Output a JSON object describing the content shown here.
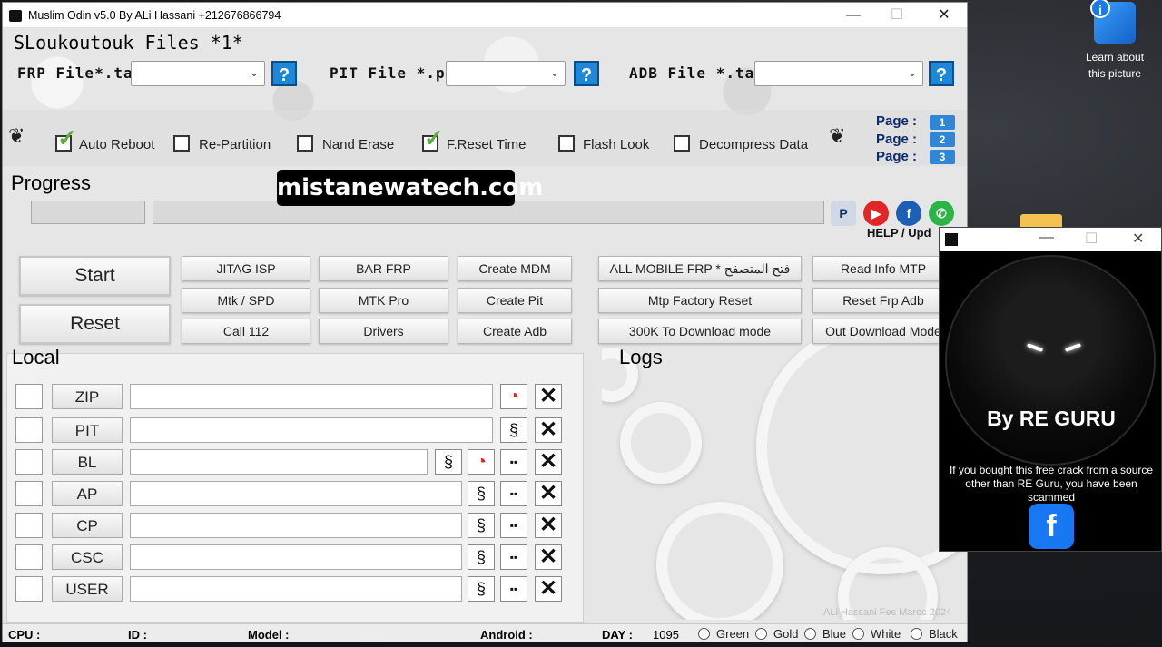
{
  "desktop": {
    "icon_label": "Learn about this picture"
  },
  "window": {
    "title": "Muslim Odin v5.0 By ALi Hassani +212676866794",
    "minimize": "—",
    "maximize": "☐",
    "close": "✕"
  },
  "header": {
    "files_label": "SLoukoutouk Files *1*",
    "frp_label": "FRP File*.tar",
    "pit_label": "PIT File *.pit",
    "adb_label": "ADB File *.tar",
    "help_glyph": "?"
  },
  "options": {
    "items": [
      {
        "label": "Auto Reboot",
        "checked": true
      },
      {
        "label": "Re-Partition",
        "checked": false
      },
      {
        "label": "Nand Erase",
        "checked": false
      },
      {
        "label": "F.Reset Time",
        "checked": true
      },
      {
        "label": "Flash Look",
        "checked": false
      },
      {
        "label": "Decompress Data",
        "checked": false
      }
    ],
    "pages": [
      {
        "label": "Page :",
        "num": "1"
      },
      {
        "label": "Page :",
        "num": "2"
      },
      {
        "label": "Page :",
        "num": "3"
      }
    ]
  },
  "progress": {
    "label": "Progress",
    "help_update": "HELP / Upd"
  },
  "watermark": "mistanewatech.com",
  "buttons": {
    "start": "Start",
    "reset": "Reset",
    "grid": [
      "JITAG ISP",
      "BAR FRP",
      "Create MDM",
      "Mtk / SPD",
      "MTK Pro",
      "Create Pit",
      "Call 112",
      "Drivers",
      "Create Adb"
    ],
    "right": [
      "ALL MOBILE FRP * فتح المتصفح",
      "Read Info MTP",
      "Mtp Factory Reset",
      "Reset Frp Adb",
      "300K To Download mode",
      "Out Download Mode"
    ]
  },
  "local": {
    "label": "Local",
    "slots": [
      "ZIP",
      "PIT",
      "BL",
      "AP",
      "CP",
      "CSC",
      "USER"
    ]
  },
  "logs": {
    "label": "Logs",
    "credit": "ALi Hassani Fes Maroc 2024"
  },
  "status": {
    "cpu": "CPU :",
    "id": "ID :",
    "model": "Model :",
    "android": "Android :",
    "day_label": "DAY :",
    "day_value": "1095",
    "themes": [
      "Green",
      "Gold",
      "Blue",
      "White",
      "Black"
    ]
  },
  "popup": {
    "brand": "By RE GURU",
    "warning": "If you bought this free crack from a source other than RE Guru, you have been scammed",
    "fb_glyph": "f"
  },
  "colors": {
    "accent_blue": "#1e88d8",
    "check_green": "#5cad3a",
    "facebook": "#1877f2"
  }
}
